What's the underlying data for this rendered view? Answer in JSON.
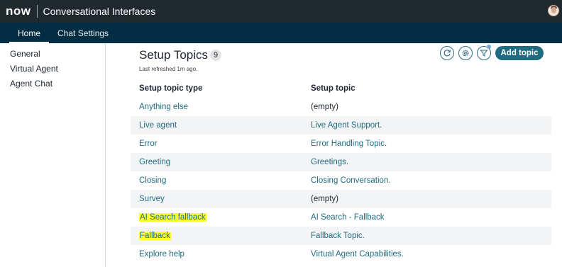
{
  "header": {
    "logo": "now",
    "app_title": "Conversational Interfaces"
  },
  "nav": {
    "tabs": [
      {
        "label": "Home",
        "active": true
      },
      {
        "label": "Chat Settings",
        "active": false
      }
    ]
  },
  "sidebar": {
    "items": [
      {
        "label": "General"
      },
      {
        "label": "Virtual Agent"
      },
      {
        "label": "Agent Chat"
      }
    ]
  },
  "main": {
    "title": "Setup Topics",
    "count": "9",
    "refresh_text": "Last refreshed 1m ago.",
    "add_button_label": "Add topic",
    "toolbar_icons": [
      "refresh-icon",
      "gear-icon",
      "filter-icon"
    ],
    "table": {
      "headers": [
        "Setup topic type",
        "Setup topic"
      ],
      "rows": [
        {
          "type": "Anything else",
          "topic": "(empty)",
          "highlighted": false
        },
        {
          "type": "Live agent",
          "topic": "Live Agent Support.",
          "highlighted": false
        },
        {
          "type": "Error",
          "topic": "Error Handling Topic.",
          "highlighted": false
        },
        {
          "type": "Greeting",
          "topic": "Greetings.",
          "highlighted": false
        },
        {
          "type": "Closing",
          "topic": "Closing Conversation.",
          "highlighted": false
        },
        {
          "type": "Survey",
          "topic": "(empty)",
          "highlighted": false
        },
        {
          "type": "AI Search fallback",
          "topic": "AI Search - Fallback",
          "highlighted": true
        },
        {
          "type": "Fallback",
          "topic": "Fallback Topic.",
          "highlighted": true
        },
        {
          "type": "Explore help",
          "topic": "Virtual Agent Capabilities.",
          "highlighted": false
        }
      ]
    }
  },
  "colors": {
    "topbar": "#202a2e",
    "navbar": "#032d42",
    "link": "#1f6b80",
    "highlight": "#ffff2e",
    "button": "#1f6b80"
  }
}
